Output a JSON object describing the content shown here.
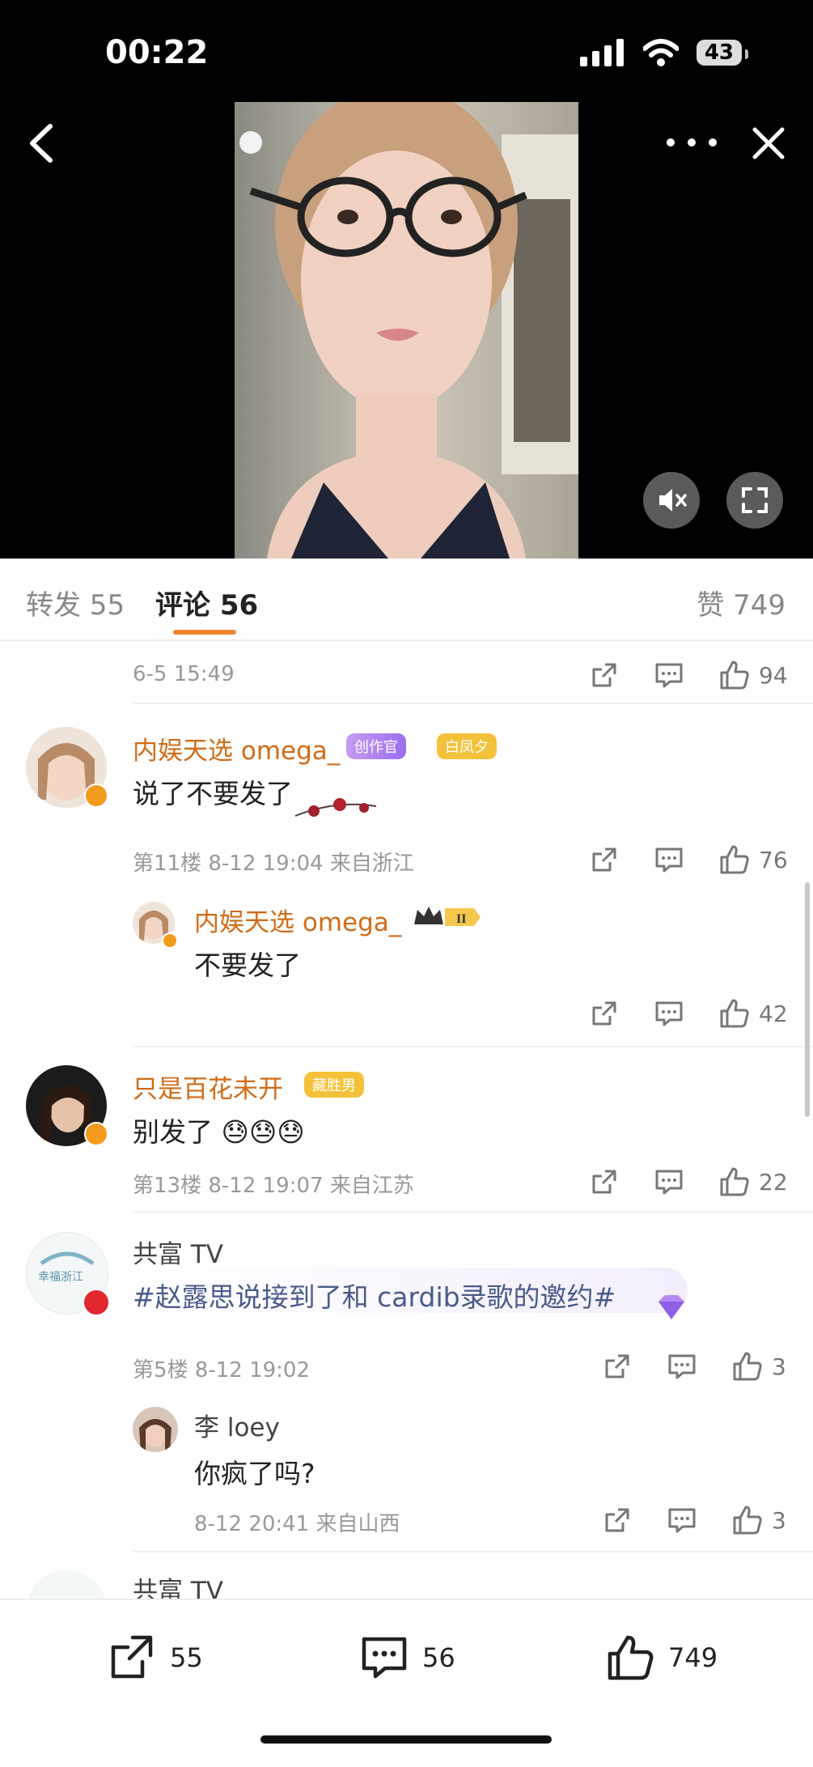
{
  "status": {
    "time": "00:22",
    "battery": "43"
  },
  "tabs": {
    "repost": "转发 55",
    "comment": "评论 56",
    "like": "赞 749"
  },
  "comments": [
    {
      "meta": "6-5 15:49",
      "likes": "94"
    },
    {
      "user": "内娱天选 omega_",
      "badge1": "创作官",
      "badge2": "白凤夕",
      "text": "说了不要发了",
      "meta": "第11楼 8-12 19:04 来自浙江",
      "likes": "76"
    },
    {
      "user": "内娱天选 omega_",
      "text": "不要发了",
      "likes": "42"
    },
    {
      "user": "只是百花未开",
      "badge1": "藏胜男",
      "text": "别发了 😓😓😓",
      "meta": "第13楼 8-12 19:07 来自江苏",
      "likes": "22"
    },
    {
      "user": "共富 TV",
      "avatar_text": "幸福浙江",
      "text": "#赵露思说接到了和 cardib录歌的邀约#",
      "meta": "第5楼 8-12 19:02",
      "likes": "3"
    },
    {
      "user": "李 loey",
      "text": "你疯了吗?",
      "meta": "8-12 20:41 来自山西",
      "likes": "3"
    },
    {
      "user": "共富 TV"
    }
  ],
  "bottom": {
    "repost": "55",
    "comment": "56",
    "like": "749"
  },
  "colors": {
    "accent": "#f0842c",
    "username": "#d26b17"
  }
}
